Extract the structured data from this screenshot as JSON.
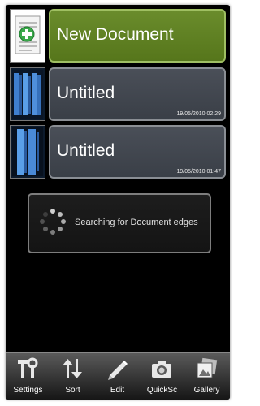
{
  "new_document": {
    "label": "New Document",
    "icon": "new-document-icon"
  },
  "documents": [
    {
      "title": "Untitled",
      "date": "19/05/2010 02:29"
    },
    {
      "title": "Untitled",
      "date": "19/05/2010 01:47"
    }
  ],
  "progress_dialog": {
    "message": "Searching for Document edges",
    "icon": "spinner-icon"
  },
  "bottom_bar": {
    "items": [
      {
        "label": "Settings",
        "icon": "tools-icon"
      },
      {
        "label": "Sort",
        "icon": "sort-arrows-icon"
      },
      {
        "label": "Edit",
        "icon": "pencil-icon"
      },
      {
        "label": "QuickSc",
        "icon": "camera-icon"
      },
      {
        "label": "Gallery",
        "icon": "gallery-icon"
      }
    ]
  },
  "colors": {
    "new_card": "#6a8c2c",
    "doc_card": "#4a4f58",
    "background": "#000000"
  }
}
